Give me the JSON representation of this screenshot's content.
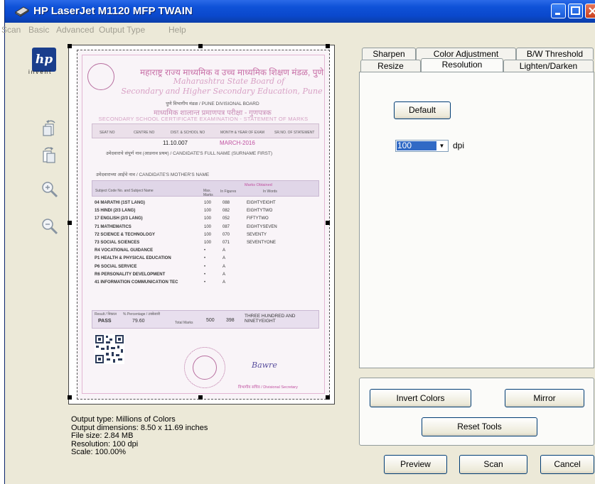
{
  "window": {
    "title": "HP LaserJet M1120 MFP TWAIN"
  },
  "menu": [
    "Scan",
    "Basic",
    "Advanced",
    "Output Type",
    "Help"
  ],
  "logo": {
    "text": "hp",
    "subtext": "invent"
  },
  "tabs": {
    "row1": [
      "Sharpen",
      "Color Adjustment",
      "B/W Threshold"
    ],
    "row2": [
      "Resize",
      "Resolution",
      "Lighten/Darken"
    ],
    "active": "Resolution"
  },
  "resolution_panel": {
    "default_label": "Default",
    "dpi_value": "100",
    "dpi_unit": "dpi"
  },
  "tools": {
    "invert_label": "Invert Colors",
    "mirror_label": "Mirror",
    "reset_label": "Reset Tools"
  },
  "actions": {
    "preview_label": "Preview",
    "scan_label": "Scan",
    "cancel_label": "Cancel"
  },
  "info": {
    "output_type": "Output type:  Millions of Colors",
    "output_dimensions": "Output dimensions:  8.50 x 11.69 inches",
    "file_size": "File size:  2.84 MB",
    "resolution": "Resolution:  100 dpi",
    "scale": "Scale:  100.00%"
  },
  "document": {
    "header_marathi": "महाराष्ट्र राज्य माध्यमिक व उच्च माध्यमिक शिक्षण मंडळ, पुणे",
    "header_marathi_2": "Maharashtra State Board of",
    "header_en": "Secondary and Higher Secondary Education, Pune",
    "division": "पुणे विभागीय मंडळ / PUNE DIVISIONAL BOARD",
    "exam_marathi": "माध्यमिक शालान्त प्रमाणपत्र परीक्षा - गुणपत्रक",
    "exam_en": "SECONDARY SCHOOL CERTIFICATE EXAMINATION - STATEMENT OF MARKS",
    "col_seat": "SEAT NO",
    "col_centre": "CENTRE NO",
    "col_dist": "DIST. & SCHOOL NO",
    "col_month": "MONTH & YEAR OF EXAM",
    "col_sr": "SR.NO. OF STATEMENT",
    "dist_value": "11.10.007",
    "month_value": "MARCH-2016",
    "name_label": "उमेदवाराचे संपूर्ण नाव (आडनाव प्रथम) / CANDIDATE'S FULL NAME (SURNAME FIRST)",
    "mother_label": "उमेदवाराच्या आईचे नाव / CANDIDATE'S MOTHER'S NAME",
    "subject_header": "Subject Code No. and Subject Name",
    "max_header": "Max. Marks",
    "obtained_header": "Marks Obtained",
    "figures_header": "In Figures",
    "words_header": "In Words",
    "subjects": [
      {
        "name": "04 MARATHI (1ST LANG)",
        "max": "100",
        "fig": "088",
        "words": "EIGHTYEIGHT"
      },
      {
        "name": "15 HINDI (2/3 LANG)",
        "max": "100",
        "fig": "082",
        "words": "EIGHTYTWO"
      },
      {
        "name": "17 ENGLISH (2/3 LANG)",
        "max": "100",
        "fig": "052",
        "words": "FIFTYTWO"
      },
      {
        "name": "71 MATHEMATICS",
        "max": "100",
        "fig": "087",
        "words": "EIGHTYSEVEN"
      },
      {
        "name": "72 SCIENCE & TECHNOLOGY",
        "max": "100",
        "fig": "070",
        "words": "SEVENTY"
      },
      {
        "name": "73 SOCIAL SCIENCES",
        "max": "100",
        "fig": "071",
        "words": "SEVENTYONE"
      },
      {
        "name": "R4 VOCATIONAL GUIDANCE",
        "max": "•",
        "fig": "A",
        "words": ""
      },
      {
        "name": "P1 HEALTH & PHYSICAL EDUCATION",
        "max": "•",
        "fig": "A",
        "words": ""
      },
      {
        "name": "P6 SOCIAL SERVICE",
        "max": "•",
        "fig": "A",
        "words": ""
      },
      {
        "name": "R6 PERSONALITY DEVELOPMENT",
        "max": "•",
        "fig": "A",
        "words": ""
      },
      {
        "name": "41 INFORMATION COMMUNICATION TEC",
        "max": "•",
        "fig": "A",
        "words": ""
      }
    ],
    "result_label": "Result / निकाल",
    "result_value": "PASS",
    "percentage_label": "% Percentage / टक्केवारी",
    "percentage_value": "79.60",
    "total_label": "Total Marks",
    "total_max": "500",
    "total_obtained": "398",
    "total_words": "THREE HUNDRED AND NINETYEIGHT",
    "signature_label": "विभागीय सचिव / Divisional Secretary",
    "signature": "Bawre"
  }
}
